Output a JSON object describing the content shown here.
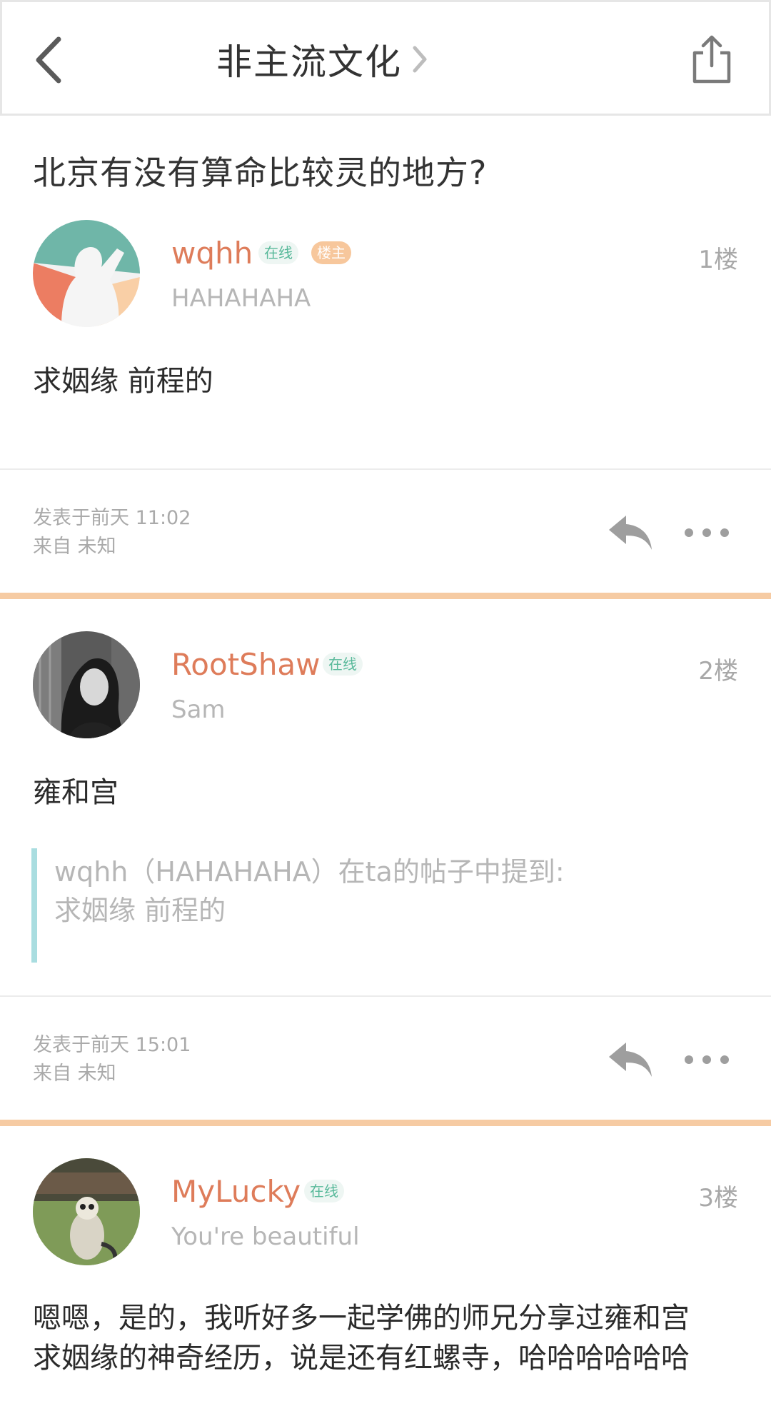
{
  "header": {
    "forum_title": "非主流文化",
    "back_icon": "chevron-left-icon",
    "share_icon": "share-icon",
    "title_chevron_icon": "chevron-right-icon"
  },
  "thread": {
    "title": "北京有没有算命比较灵的地方?"
  },
  "colors": {
    "username": "#de7c5a",
    "separator": "#f6cba3",
    "online_badge": "#58b99a",
    "quote_bar": "#a9dde0"
  },
  "posts": [
    {
      "username": "wqhh",
      "online_badge": "在线",
      "owner_badge": "楼主",
      "signature": "HAHAHAHA",
      "floor": "1楼",
      "content": "求姻缘 前程的",
      "posted_at": "发表于前天 11:02",
      "source": "来自 未知"
    },
    {
      "username": "RootShaw",
      "online_badge": "在线",
      "signature": "Sam",
      "floor": "2楼",
      "content": "雍和宫",
      "quote": {
        "line1": "wqhh（HAHAHAHA）在ta的帖子中提到:",
        "line2": "求姻缘 前程的"
      },
      "posted_at": "发表于前天 15:01",
      "source": "来自 未知"
    },
    {
      "username": "MyLucky",
      "online_badge": "在线",
      "signature": "You're beautiful",
      "floor": "3楼",
      "content_line1": "嗯嗯，是的，我听好多一起学佛的师兄分享过雍和宫",
      "content_line2": "求姻缘的神奇经历，说是还有红螺寺，哈哈哈哈哈哈"
    }
  ]
}
